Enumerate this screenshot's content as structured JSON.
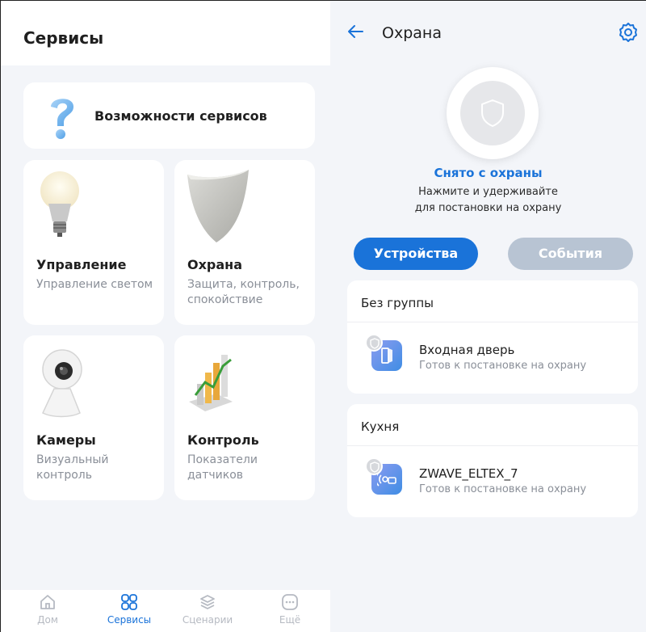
{
  "left": {
    "title": "Сервисы",
    "features_card": {
      "label": "Возможности сервисов",
      "icon": "question-mark-icon"
    },
    "tiles": [
      {
        "title": "Управление",
        "desc": "Управление светом",
        "icon": "light-bulb-icon"
      },
      {
        "title": "Охрана",
        "desc": "Защита, контроль, спокойствие",
        "icon": "shield-icon"
      },
      {
        "title": "Камеры",
        "desc": "Визуальный контроль",
        "icon": "camera-icon"
      },
      {
        "title": "Контроль",
        "desc": "Показатели датчиков",
        "icon": "bar-chart-icon"
      }
    ],
    "nav": [
      {
        "label": "Дом",
        "icon": "home-icon",
        "active": false
      },
      {
        "label": "Сервисы",
        "icon": "grid-icon",
        "active": true
      },
      {
        "label": "Сценарии",
        "icon": "layers-icon",
        "active": false
      },
      {
        "label": "Ещё",
        "icon": "more-icon",
        "active": false
      }
    ]
  },
  "right": {
    "title": "Охрана",
    "status": "Снято с охраны",
    "hint_line1": "Нажмите и удерживайте",
    "hint_line2": "для постановки на охрану",
    "tabs": {
      "devices": "Устройства",
      "events": "События"
    },
    "groups": [
      {
        "title": "Без группы",
        "device": {
          "name": "Входная дверь",
          "state": "Готов к постановке на охрану",
          "icon": "door-sensor-icon"
        }
      },
      {
        "title": "Кухня",
        "device": {
          "name": "ZWAVE_ELTEX_7",
          "state": "Готов к постановке на охрану",
          "icon": "motion-sensor-icon"
        }
      }
    ]
  },
  "colors": {
    "accent": "#1a73d9",
    "inactive_tab": "#b8c4d3",
    "background": "#f3f5f9",
    "muted_text": "#8a8f98"
  }
}
